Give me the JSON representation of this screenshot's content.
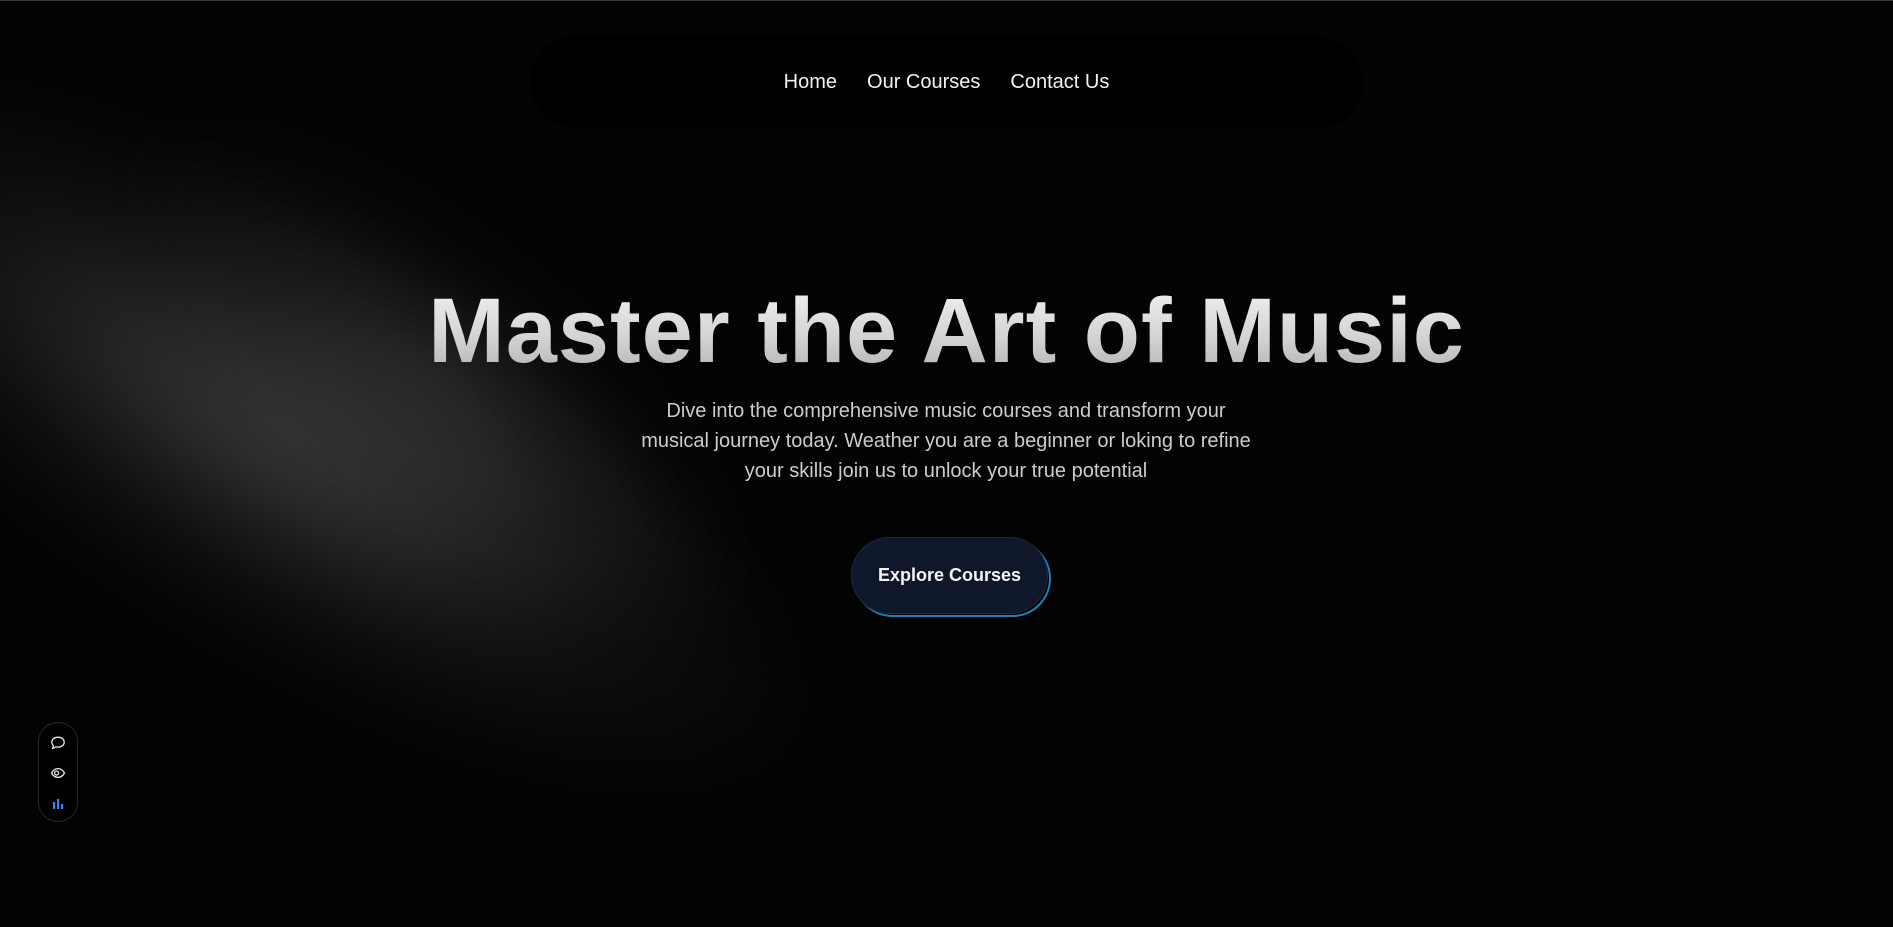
{
  "nav": {
    "links": [
      {
        "label": "Home"
      },
      {
        "label": "Our Courses"
      },
      {
        "label": "Contact Us"
      }
    ]
  },
  "hero": {
    "title": "Master the Art of Music",
    "subtitle": "Dive into the comprehensive music courses and transform your musical journey today. Weather you are a beginner or loking to refine your skills join us to unlock your true potential",
    "cta_label": "Explore Courses"
  },
  "toolbar": {
    "icons": [
      "comment-icon",
      "eye-icon",
      "bar-chart-icon"
    ]
  },
  "colors": {
    "background": "#030303",
    "cta_background": "#0f172b",
    "cta_accent": "#1f7fb8",
    "text_primary": "#f2f2f2",
    "text_secondary": "#cdcdcd"
  }
}
